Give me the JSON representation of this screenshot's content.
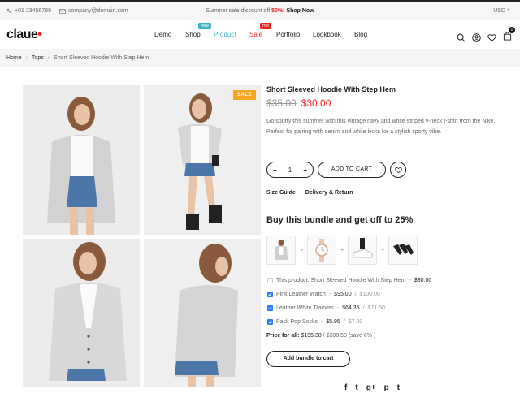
{
  "topbar": {
    "phone": "+01 23456789",
    "email": "company@domain.com",
    "promo_text": "Summer sale discount off",
    "promo_pct": "50%!",
    "promo_link": "Shop Now",
    "currency": "USD ˅"
  },
  "header": {
    "logo": "claue",
    "cart_count": "0",
    "nav": [
      {
        "label": "Demo"
      },
      {
        "label": "Shop",
        "badge": "New"
      },
      {
        "label": "Product"
      },
      {
        "label": "Sale",
        "badge": "Hot"
      },
      {
        "label": "Portfolio"
      },
      {
        "label": "Lookbook"
      },
      {
        "label": "Blog"
      }
    ]
  },
  "breadcrumb": {
    "home": "Home",
    "sep": "›",
    "category": "Tops",
    "current": "Short Sleeved Hoodie With Step Hem"
  },
  "gallery": {
    "sale_tag": "SALE"
  },
  "product": {
    "title": "Short Sleeved Hoodie With Step Hem",
    "old_price": "$35.00",
    "price": "$30.00",
    "description": "Go sporty this summer with this vintage navy and white striped v-neck t-shirt from the Nike. Perfect for pairing with denim and white kicks for a stylish sporty vibe.",
    "qty": "1",
    "minus": "−",
    "plus": "+",
    "add_to_cart": "ADD TO CART",
    "size_guide": "Size Guide",
    "delivery": "Delivery & Return"
  },
  "bundle": {
    "title": "Buy this bundle and get off to 25%",
    "plus_sign": "+",
    "items": [
      {
        "label": "This product: Short Sleeved Hoodie With Step Hem",
        "sep": " - ",
        "price": "$30.00",
        "old": ""
      },
      {
        "label": "Pink Leather Watch",
        "sep": " - ",
        "price": "$95.00",
        "old": "$100.00"
      },
      {
        "label": "Leather White Trainers",
        "sep": " - ",
        "price": "$64.35",
        "old": "$71.50"
      },
      {
        "label": "Pack Pop Socks",
        "sep": " - ",
        "price": "$5.95",
        "old": "$7.00"
      }
    ],
    "total_label": "Price for all:",
    "total_new": "$195.30",
    "total_old": "$208.50",
    "total_save": "(save 6% )",
    "button": "Add bundle to cart"
  },
  "social": {
    "facebook": "f",
    "twitter": "t",
    "google": "g+",
    "pinterest": "p",
    "tumblr": "t"
  },
  "colors": {
    "accent": "#3ab4c8",
    "sale": "#e22222",
    "sale_tag": "#f5a623",
    "check": "#2f7cf6"
  }
}
